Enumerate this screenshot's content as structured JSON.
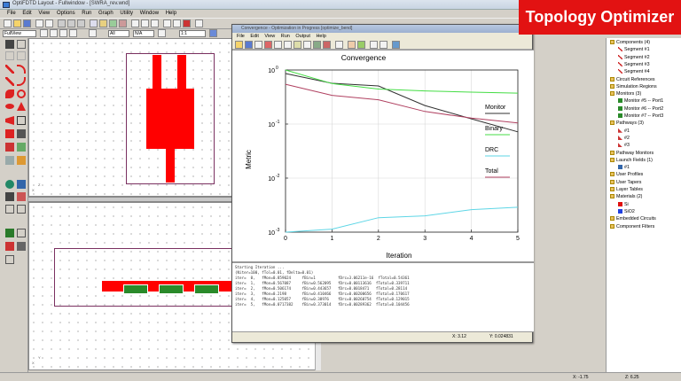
{
  "window": {
    "title": "OptiFDTD Layout - Fullwindow - [SWRA_rev.wnd]"
  },
  "menu": [
    "File",
    "Edit",
    "View",
    "Options",
    "Run",
    "Graph",
    "Utility",
    "Window",
    "Help"
  ],
  "toolbar2": {
    "wafer": "FullView",
    "zoom": "1:1",
    "mode": "All",
    "ysel": "N/A"
  },
  "dialog": {
    "title": "Convergence - Optimization in Progress [optimize_bend]",
    "menu": [
      "File",
      "Edit",
      "View",
      "Run",
      "Output",
      "Help"
    ],
    "status": {
      "x": "X: 3.12",
      "y": "Y: 0.024831"
    },
    "console": [
      "Starting Iteration ...",
      "(Niter=100, fTol=0.01, fDelta=0.01)",
      "",
      "iter=  0,   fMon=0.859024     fBin=1          fDrc=3.06211e-16  fTotal=0.54361",
      "iter=  1,   fMon=0.567087     fBin=0.562095   fDrc=0.00113616  fTotal=0.339711",
      "iter=  2,   fMon=0.506174     fBin=0.443657   fDrc=0.0018471   fTotal=0.28114",
      "iter=  3,   fMon=0.2198       fBin=0.410466   fDrc=0.00200656  fTotal=0.170617",
      "iter=  4,   fMon=0.125057     fBin=0.38976    fDrc=0.00260754  fTotal=0.129015",
      "iter=  5,   fMon=0.0717382    fBin=0.373014   fDrc=0.00289362  fTotal=0.104456"
    ]
  },
  "chart_data": {
    "type": "line",
    "title": "Convergence",
    "xlabel": "Iteration",
    "ylabel": "Metric",
    "xlim": [
      0,
      5
    ],
    "ylim": [
      0.001,
      1
    ],
    "yscale": "log",
    "x_ticks": [
      "0",
      "1",
      "2",
      "3",
      "4",
      "5"
    ],
    "y_ticks": [
      "10",
      "10",
      "10",
      "10"
    ],
    "y_tick_exponents": [
      "0",
      "-1",
      "-2",
      "-3"
    ],
    "x": [
      0,
      1,
      2,
      3,
      4,
      5
    ],
    "series": [
      {
        "name": "Monitor",
        "color": "#303030",
        "values": [
          0.859024,
          0.567087,
          0.506174,
          0.2198,
          0.125057,
          0.0717382
        ]
      },
      {
        "name": "Binary",
        "color": "#44dd44",
        "values": [
          1,
          0.562095,
          0.443657,
          0.410466,
          0.38976,
          0.373014
        ]
      },
      {
        "name": "DRC",
        "color": "#5ed6e6",
        "values": [
          0.001,
          0.00113616,
          0.0018471,
          0.00200656,
          0.00260754,
          0.00289362
        ]
      },
      {
        "name": "Total",
        "color": "#b04060",
        "values": [
          0.54361,
          0.339711,
          0.28114,
          0.170617,
          0.129015,
          0.104456
        ]
      }
    ],
    "legend_position": "right"
  },
  "tree": {
    "items": [
      {
        "label": "Components (4)",
        "level": 0,
        "icon": "folder"
      },
      {
        "label": "Segment #1",
        "level": 1,
        "icon": "segment"
      },
      {
        "label": "Segment #2",
        "level": 1,
        "icon": "segment"
      },
      {
        "label": "Segment #3",
        "level": 1,
        "icon": "segment"
      },
      {
        "label": "Segment #4",
        "level": 1,
        "icon": "segment"
      },
      {
        "label": "Circuit References",
        "level": 0,
        "icon": "folder"
      },
      {
        "label": "Simulation Regions",
        "level": 0,
        "icon": "folder"
      },
      {
        "label": "Monitors (3)",
        "level": 0,
        "icon": "folder"
      },
      {
        "label": "Monitor #5 -- Port1",
        "level": 1,
        "icon": "monitor"
      },
      {
        "label": "Monitor #6 -- Port2",
        "level": 1,
        "icon": "monitor"
      },
      {
        "label": "Monitor #7 -- Port3",
        "level": 1,
        "icon": "monitor"
      },
      {
        "label": "Pathways (3)",
        "level": 0,
        "icon": "folder"
      },
      {
        "label": "#1",
        "level": 1,
        "icon": "pathway"
      },
      {
        "label": "#2",
        "level": 1,
        "icon": "pathway"
      },
      {
        "label": "#3",
        "level": 1,
        "icon": "pathway"
      },
      {
        "label": "Pathway Monitors",
        "level": 0,
        "icon": "folder"
      },
      {
        "label": "Launch Fields (1)",
        "level": 0,
        "icon": "folder"
      },
      {
        "label": "#1",
        "level": 1,
        "icon": "launch"
      },
      {
        "label": "User Profiles",
        "level": 0,
        "icon": "folder"
      },
      {
        "label": "User Tapers",
        "level": 0,
        "icon": "folder"
      },
      {
        "label": "Layer Tables",
        "level": 0,
        "icon": "folder"
      },
      {
        "label": "Materials (2)",
        "level": 0,
        "icon": "folder"
      },
      {
        "label": "Si",
        "level": 1,
        "icon": "mat-red"
      },
      {
        "label": "SiO2",
        "level": 1,
        "icon": "mat-blue"
      },
      {
        "label": "Embedded Circuits",
        "level": 0,
        "icon": "folder"
      },
      {
        "label": "Component Filters",
        "level": 0,
        "icon": "folder"
      }
    ]
  },
  "badge": {
    "text": "Topology Optimizer",
    "color": "#e21212"
  },
  "statusbar": {
    "x": "X: -1.75",
    "z": "Z: 6.25"
  },
  "layout_top": {
    "axis_labels": [
      "X",
      "Z"
    ]
  },
  "layout_bottom": {
    "axis_labels": [
      "X",
      "Y"
    ]
  },
  "colors": {
    "structure": "#ff0000",
    "monitor": "#2a8a2a",
    "outline": "#7a3060"
  }
}
